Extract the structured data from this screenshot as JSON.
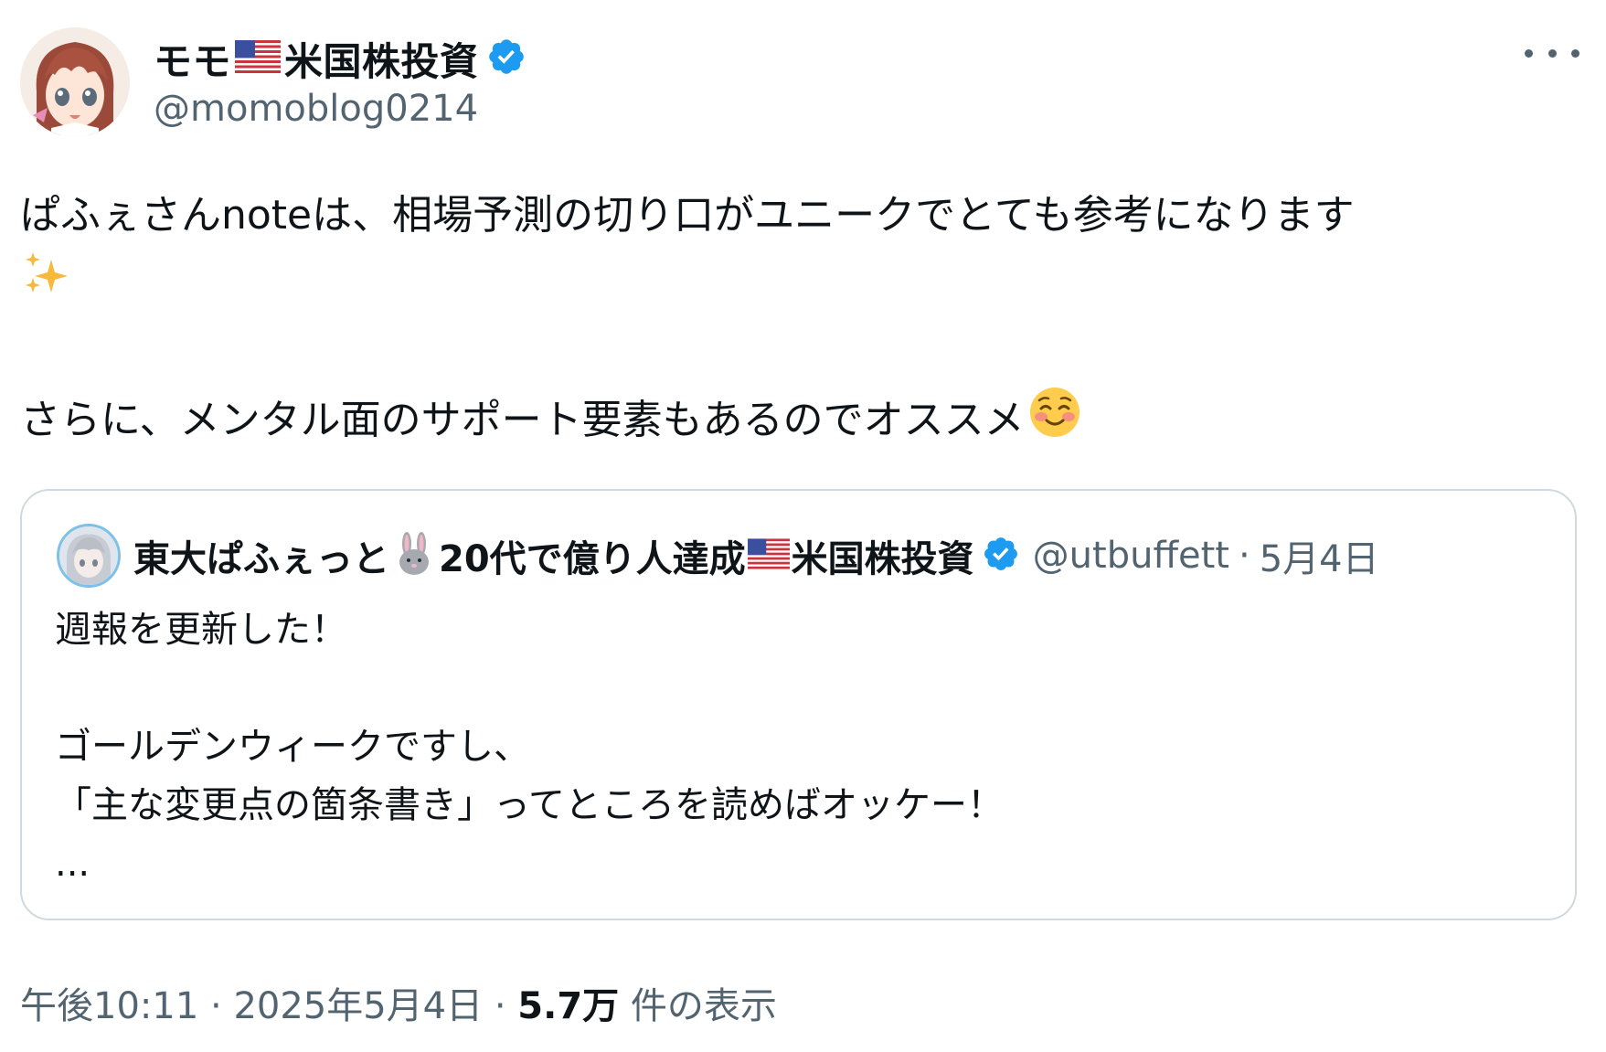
{
  "author": {
    "name_part1": "モモ",
    "name_part2": "米国株投資",
    "handle": "@momoblog0214",
    "verified": true
  },
  "tweet": {
    "line1": "ぱふぇさんnoteは、相場予測の切り口がユニークでとても参考になります",
    "line2": "さらに、メンタル面のサポート要素もあるのでオススメ",
    "emoji_sparkles": "sparkles-emoji",
    "emoji_smile": "smiling-blush-emoji"
  },
  "quote": {
    "name_part1": "東大ぱふぇっと",
    "name_part2": "20代で億り人達成",
    "name_part3": "米国株投資",
    "handle": "@utbuffett",
    "separator": "·",
    "date": "5月4日",
    "text_line1": "週報を更新した！",
    "text_line2": "ゴールデンウィークですし、",
    "text_line3": "「主な変更点の箇条書き」ってところを読めばオッケー！",
    "text_line4": "..."
  },
  "footer": {
    "time": "午後10:11",
    "sep1": "·",
    "date": "2025年5月4日",
    "sep2": "·",
    "views_count": "5.7万",
    "views_label": "件の表示"
  },
  "colors": {
    "text": "#0f1419",
    "secondary": "#536471",
    "verified_blue": "#1d9bf0",
    "border": "#cfd9de"
  }
}
